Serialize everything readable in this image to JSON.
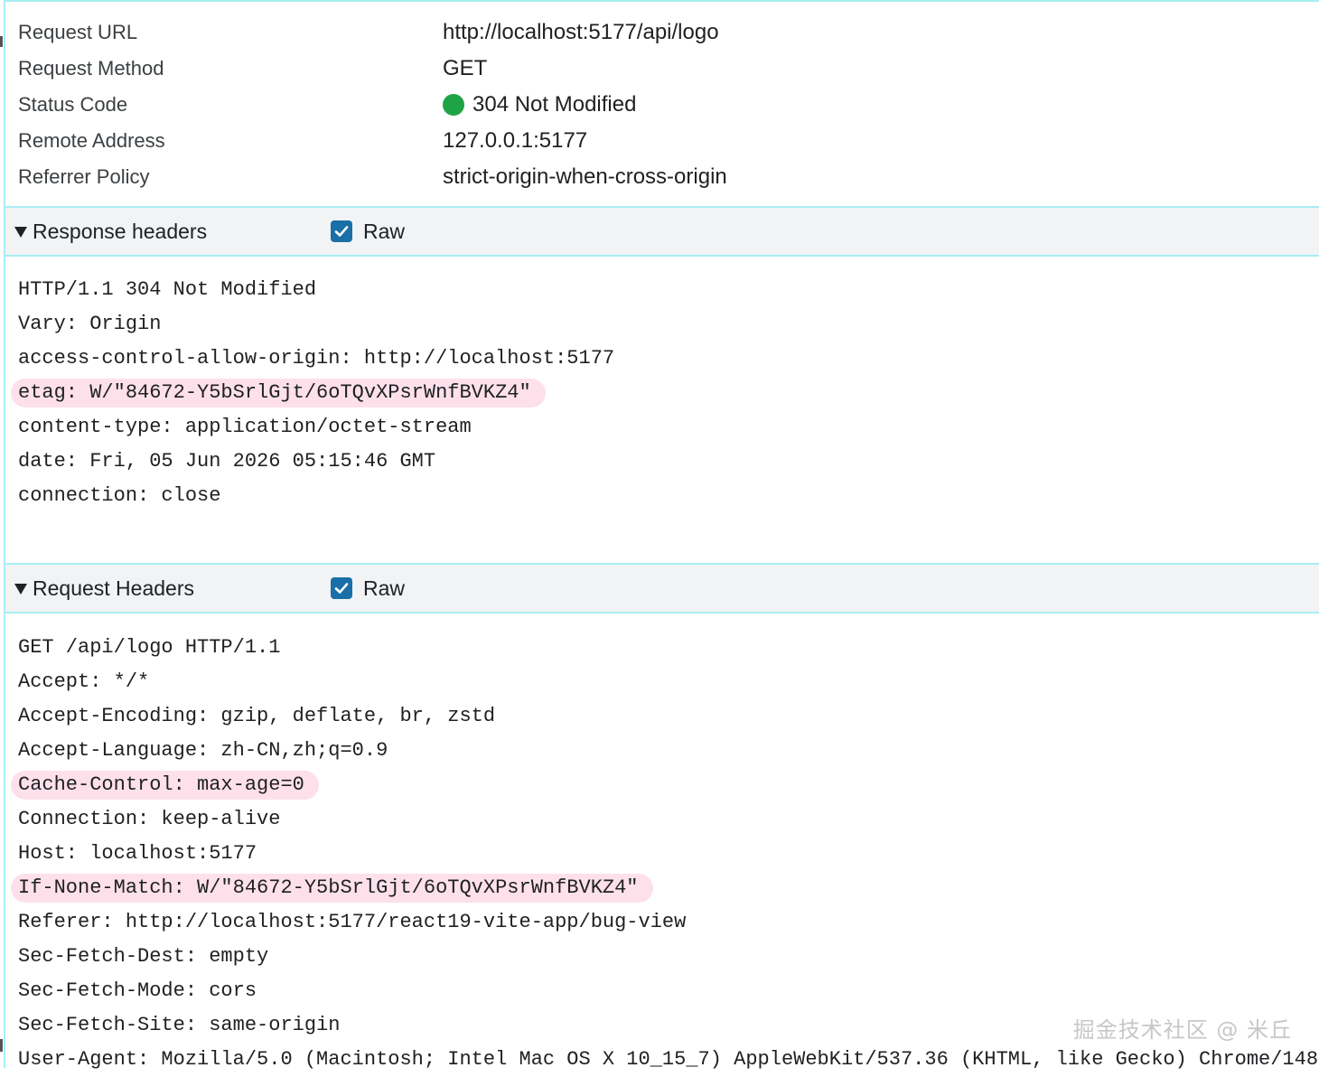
{
  "general": [
    {
      "key": "Request URL",
      "value": "http://localhost:5177/api/logo"
    },
    {
      "key": "Request Method",
      "value": "GET"
    },
    {
      "key": "Status Code",
      "value": "304 Not Modified",
      "status_color": "#1ea446"
    },
    {
      "key": "Remote Address",
      "value": "127.0.0.1:5177"
    },
    {
      "key": "Referrer Policy",
      "value": "strict-origin-when-cross-origin"
    }
  ],
  "response_headers": {
    "title": "Response headers",
    "raw_label": "Raw",
    "raw_checked": true,
    "lines": [
      "HTTP/1.1 304 Not Modified",
      "Vary: Origin",
      "access-control-allow-origin: http://localhost:5177",
      "etag: W/\"84672-Y5bSrlGjt/6oTQvXPsrWnfBVKZ4\"",
      "content-type: application/octet-stream",
      "date: Fri, 05 Jun 2026 05:15:46 GMT",
      "connection: close"
    ],
    "highlighted": [
      3
    ]
  },
  "request_headers": {
    "title": "Request Headers",
    "raw_label": "Raw",
    "raw_checked": true,
    "lines": [
      "GET /api/logo HTTP/1.1",
      "Accept: */*",
      "Accept-Encoding: gzip, deflate, br, zstd",
      "Accept-Language: zh-CN,zh;q=0.9",
      "Cache-Control: max-age=0",
      "Connection: keep-alive",
      "Host: localhost:5177",
      "If-None-Match: W/\"84672-Y5bSrlGjt/6oTQvXPsrWnfBVKZ4\"",
      "Referer: http://localhost:5177/react19-vite-app/bug-view",
      "Sec-Fetch-Dest: empty",
      "Sec-Fetch-Mode: cors",
      "Sec-Fetch-Site: same-origin",
      "User-Agent: Mozilla/5.0 (Macintosh; Intel Mac OS X 10_15_7) AppleWebKit/537.36 (KHTML, like Gecko) Chrome/148"
    ],
    "highlighted": [
      4,
      7
    ]
  },
  "watermark": "掘金技术社区 @ 米丘",
  "colors": {
    "highlight": "#fde0ea",
    "border": "#a8eef2",
    "checkbox": "#1a6fa8",
    "header_bg": "#f1f3f4"
  }
}
